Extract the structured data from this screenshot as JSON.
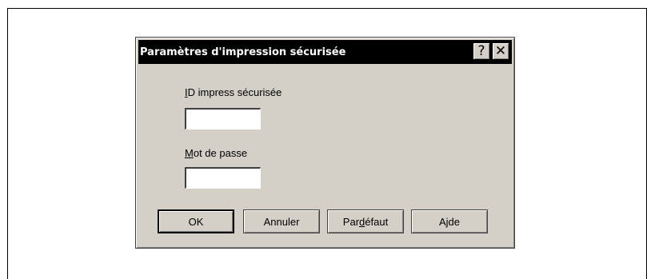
{
  "dialog": {
    "title": "Paramètres d'impression sécurisée",
    "help_button": "?",
    "close_button": "✕"
  },
  "fields": {
    "secure_id": {
      "label_underlined": "I",
      "label_rest": "D impress sécurisée",
      "value": ""
    },
    "password": {
      "label_underlined": "M",
      "label_rest": "ot de passe",
      "value": ""
    }
  },
  "buttons": {
    "ok": "OK",
    "cancel": "Annuler",
    "default_prefix": "Par ",
    "default_underlined": "d",
    "default_rest": "éfaut",
    "help_prefix": "A",
    "help_underlined": "j",
    "help_rest": "de"
  }
}
